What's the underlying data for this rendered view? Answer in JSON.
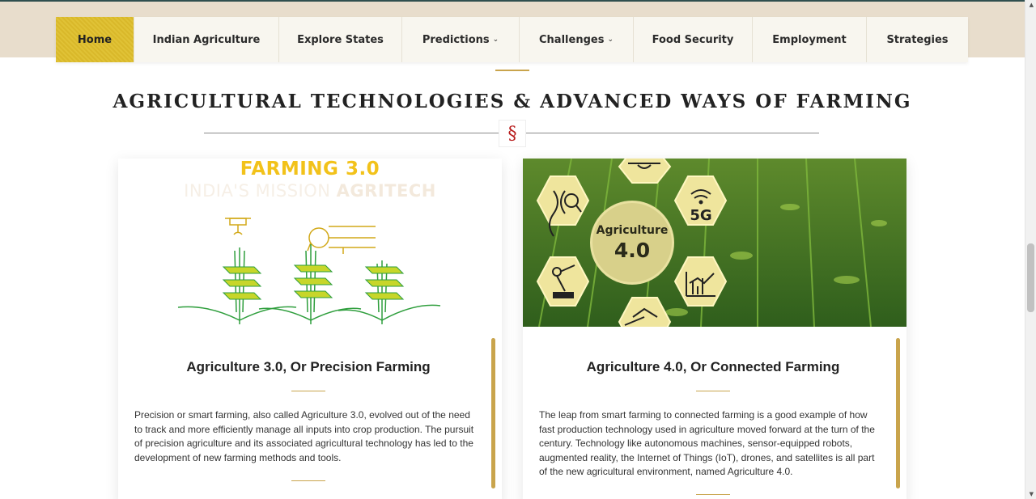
{
  "nav": {
    "items": [
      {
        "label": "Home",
        "dropdown": false,
        "active": true
      },
      {
        "label": "Indian Agriculture",
        "dropdown": false
      },
      {
        "label": "Explore States",
        "dropdown": false
      },
      {
        "label": "Predictions",
        "dropdown": true
      },
      {
        "label": "Challenges",
        "dropdown": true
      },
      {
        "label": "Food Security",
        "dropdown": false
      },
      {
        "label": "Employment",
        "dropdown": false
      },
      {
        "label": "Strategies",
        "dropdown": false
      }
    ],
    "chevron": "⌄"
  },
  "section": {
    "title": "AGRICULTURAL TECHNOLOGIES & ADVANCED WAYS OF FARMING",
    "divider_symbol": "§"
  },
  "cards": [
    {
      "image": {
        "title": "FARMING 3.0",
        "subtitle_main": "INDIA'S MISSION ",
        "subtitle_bold": "AGRITECH"
      },
      "title": "Agriculture 3.0, Or Precision Farming",
      "text": "Precision or smart farming, also called Agriculture 3.0, evolved out of the need to track and more efficiently manage all inputs into crop production. The pursuit of precision agriculture and its associated agricultural technology has led to the development of new farming methods and tools."
    },
    {
      "image": {
        "center_line1": "Agriculture",
        "center_line2": "4.0",
        "badge_5g": "5G",
        "icons": [
          "drone-icon",
          "dna-icon",
          "wifi-icon",
          "robot-arm-icon",
          "chart-icon",
          "satellite-icon"
        ]
      },
      "title": "Agriculture 4.0, Or Connected Farming",
      "text": "The leap from smart farming to connected farming is a good example of how fast production technology used in agriculture moved forward at the turn of the century. Technology like autonomous machines, sensor-equipped robots, augmented reality, the Internet of Things (IoT), drones, and satellites is all part of the new agricultural environment, named Agriculture 4.0."
    }
  ],
  "colors": {
    "band": "#e8ddcc",
    "active_nav": "#d9b82a",
    "gold": "#c9a44c",
    "section_mark": "#b81c1c",
    "farming_yellow": "#f2c21a"
  }
}
